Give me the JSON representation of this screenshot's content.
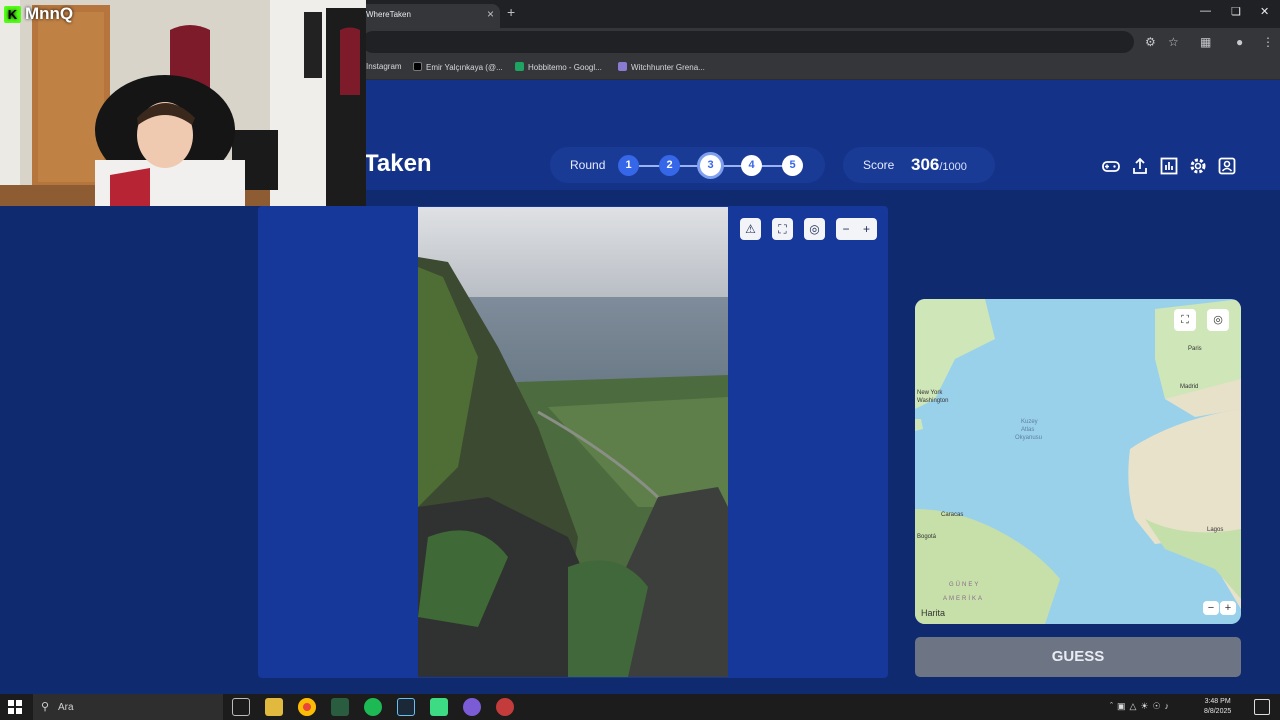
{
  "overlay": {
    "channel": "MnnQ"
  },
  "browser": {
    "tab_title": "WhereTaken",
    "close_glyph": "×",
    "newtab_glyph": "+",
    "bookmarks": [
      {
        "label": "Instagram"
      },
      {
        "label": "Emir Yalçınkaya (@..."
      },
      {
        "label": "Hobbitemo - Googl..."
      },
      {
        "label": "Witchhunter Grena..."
      }
    ]
  },
  "app": {
    "brand": "Taken",
    "round_label": "Round",
    "rounds": [
      "1",
      "2",
      "3",
      "4",
      "5"
    ],
    "current_round": 3,
    "score_label": "Score",
    "score_value": "306",
    "score_max": "/1000",
    "header_icons": [
      "gamepad-icon",
      "share-icon",
      "stats-icon",
      "settings-icon",
      "profile-icon"
    ],
    "photo_controls": {
      "report": "⚠",
      "fullscreen": "⛶",
      "recenter": "◎",
      "zoom_out": "−",
      "zoom_in": "+"
    },
    "map": {
      "labels": [
        "Paris",
        "Madrid",
        "New York",
        "Washington",
        "Kuzey",
        "Atlas",
        "Okyanusu",
        "Caracas",
        "Bogotá",
        "Lagos",
        "GÜNEY",
        "AMERİKA",
        "Harita"
      ],
      "controls": {
        "fullscreen": "⛶",
        "recenter": "◎",
        "zoom_out": "−",
        "zoom_in": "+"
      },
      "attribution": "Harita"
    },
    "guess_label": "GUESS"
  },
  "taskbar": {
    "search_placeholder": "Ara",
    "time": "3:48 PM",
    "date": "8/8/2025"
  }
}
